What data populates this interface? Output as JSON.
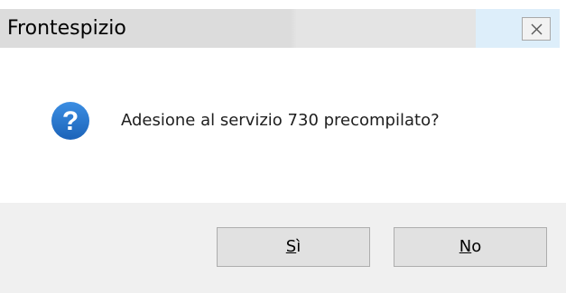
{
  "window": {
    "title": "Frontespizio",
    "close_icon": "close-icon"
  },
  "message": {
    "icon": "question-icon",
    "icon_color": "#1f6fc5",
    "text": "Adesione al servizio 730 precompilato?"
  },
  "buttons": {
    "yes": {
      "mnemonic": "S",
      "rest": "ì"
    },
    "no": {
      "mnemonic": "N",
      "rest": "o"
    }
  }
}
